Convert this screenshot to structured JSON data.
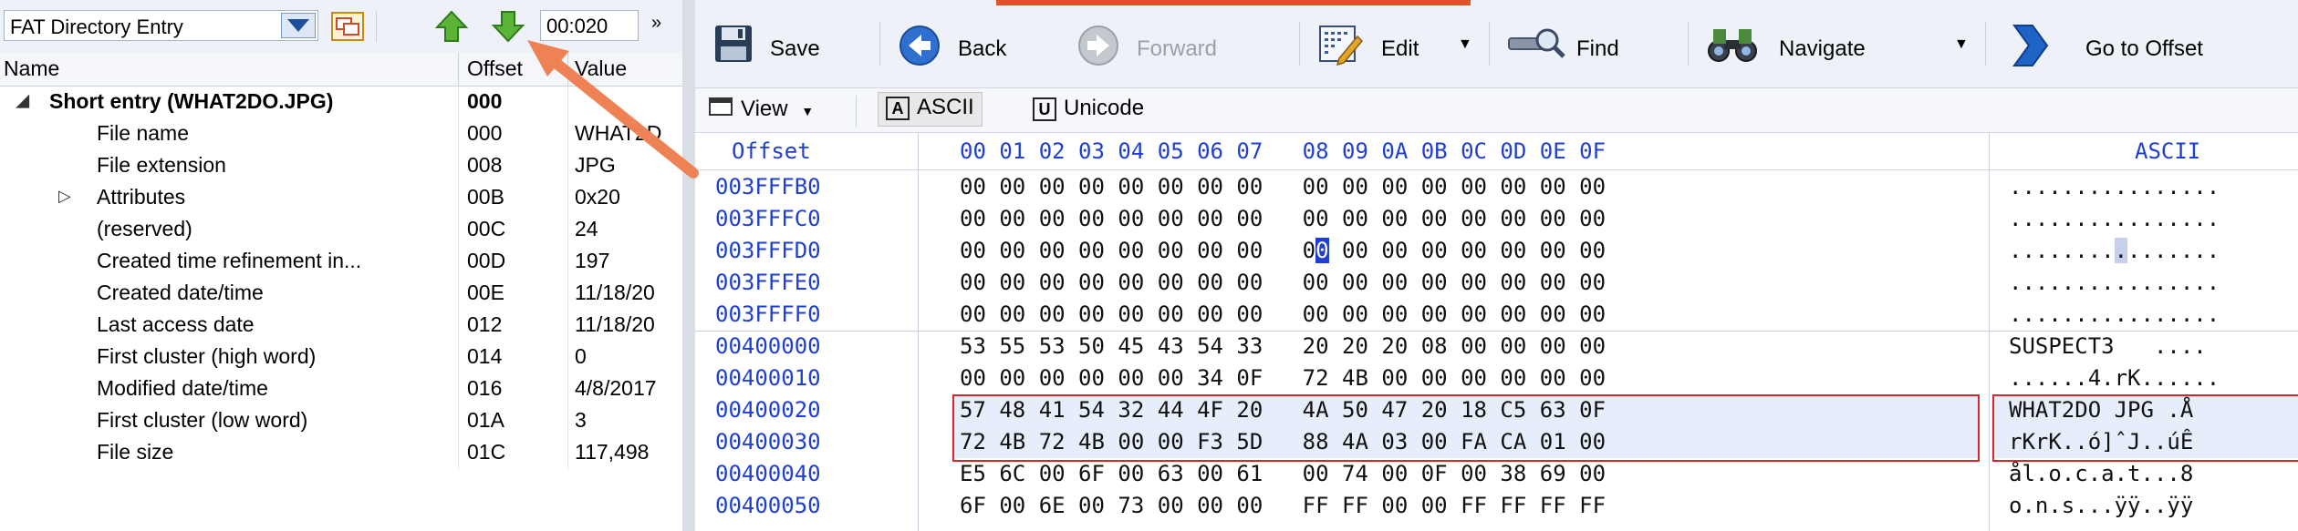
{
  "left_toolbar": {
    "template_select": "FAT Directory Entry",
    "address_value": "00:020",
    "more_glyph": "»"
  },
  "grid": {
    "headers": [
      "Name",
      "Offset",
      "Value"
    ],
    "rows": [
      {
        "name": "Short entry (WHAT2DO.JPG)",
        "offset": "000",
        "value": "",
        "bold": true,
        "indent": 0,
        "expand": "◢"
      },
      {
        "name": "File name",
        "offset": "000",
        "value": "WHAT2D",
        "indent": 1,
        "expand": ""
      },
      {
        "name": "File extension",
        "offset": "008",
        "value": "JPG",
        "indent": 1,
        "expand": ""
      },
      {
        "name": "Attributes",
        "offset": "00B",
        "value": "0x20",
        "indent": 1,
        "expand": "▷"
      },
      {
        "name": "(reserved)",
        "offset": "00C",
        "value": "24",
        "indent": 1,
        "expand": ""
      },
      {
        "name": "Created time refinement in...",
        "offset": "00D",
        "value": "197",
        "indent": 1,
        "expand": ""
      },
      {
        "name": "Created date/time",
        "offset": "00E",
        "value": "11/18/20",
        "indent": 1,
        "expand": ""
      },
      {
        "name": "Last access date",
        "offset": "012",
        "value": "11/18/20",
        "indent": 1,
        "expand": ""
      },
      {
        "name": "First cluster (high word)",
        "offset": "014",
        "value": "0",
        "indent": 1,
        "expand": ""
      },
      {
        "name": "Modified date/time",
        "offset": "016",
        "value": "4/8/2017",
        "indent": 1,
        "expand": ""
      },
      {
        "name": "First cluster (low word)",
        "offset": "01A",
        "value": "3",
        "indent": 1,
        "expand": ""
      },
      {
        "name": "File size",
        "offset": "01C",
        "value": "117,498",
        "indent": 1,
        "expand": ""
      }
    ]
  },
  "toolbar": {
    "save": "Save",
    "back": "Back",
    "forward": "Forward",
    "edit": "Edit",
    "find": "Find",
    "navigate": "Navigate",
    "goto": "Go to Offset"
  },
  "toolbar2": {
    "view": "View",
    "ascii": "ASCII",
    "unicode": "Unicode",
    "ascii_icon": "A",
    "unicode_icon": "U"
  },
  "hex": {
    "header_offset": "Offset",
    "header_cols": "00 01 02 03 04 05 06 07   08 09 0A 0B 0C 0D 0E 0F",
    "header_ascii": "ASCII",
    "rows": [
      {
        "offset": "003FFFB0",
        "bytes": "00 00 00 00 00 00 00 00   00 00 00 00 00 00 00 00",
        "ascii": "................"
      },
      {
        "offset": "003FFFC0",
        "bytes": "00 00 00 00 00 00 00 00   00 00 00 00 00 00 00 00",
        "ascii": "................"
      },
      {
        "offset": "003FFFD0",
        "bytes_a": "00 00 00 00 00 00 00 00   0",
        "bytes_cursor": "0",
        "bytes_b": " 00 00 00 00 00 00 00",
        "ascii_a": "........",
        "ascii_cursor": ".",
        "ascii_b": "......."
      },
      {
        "offset": "003FFFE0",
        "bytes": "00 00 00 00 00 00 00 00   00 00 00 00 00 00 00 00",
        "ascii": "................"
      },
      {
        "offset": "003FFFF0",
        "bytes": "00 00 00 00 00 00 00 00   00 00 00 00 00 00 00 00",
        "ascii": "................"
      },
      {
        "offset": "00400000",
        "bytes": "53 55 53 50 45 43 54 33   20 20 20 08 00 00 00 00",
        "ascii": "SUSPECT3   ...."
      },
      {
        "offset": "00400010",
        "bytes": "00 00 00 00 00 00 34 0F   72 4B 00 00 00 00 00 00",
        "ascii": "......4.rK......"
      },
      {
        "offset": "00400020",
        "bytes": "57 48 41 54 32 44 4F 20   4A 50 47 20 18 C5 63 0F",
        "ascii": "WHAT2DO JPG .Å"
      },
      {
        "offset": "00400030",
        "bytes": "72 4B 72 4B 00 00 F3 5D   88 4A 03 00 FA CA 01 00",
        "ascii": "rKrK..ó]ˆJ..úÊ"
      },
      {
        "offset": "00400040",
        "bytes": "E5 6C 00 6F 00 63 00 61   00 74 00 0F 00 38 69 00",
        "ascii": "ål.o.c.a.t...8"
      },
      {
        "offset": "00400050",
        "bytes": "6F 00 6E 00 73 00 00 00   FF FF 00 00 FF FF FF FF",
        "ascii": "o.n.s...ÿÿ..ÿÿ"
      }
    ]
  },
  "colors": {
    "accent_orange": "#e0532a",
    "hex_blue": "#1f3fd1",
    "selection_red": "#d9252b",
    "annotation_arrow": "#ef8254"
  }
}
